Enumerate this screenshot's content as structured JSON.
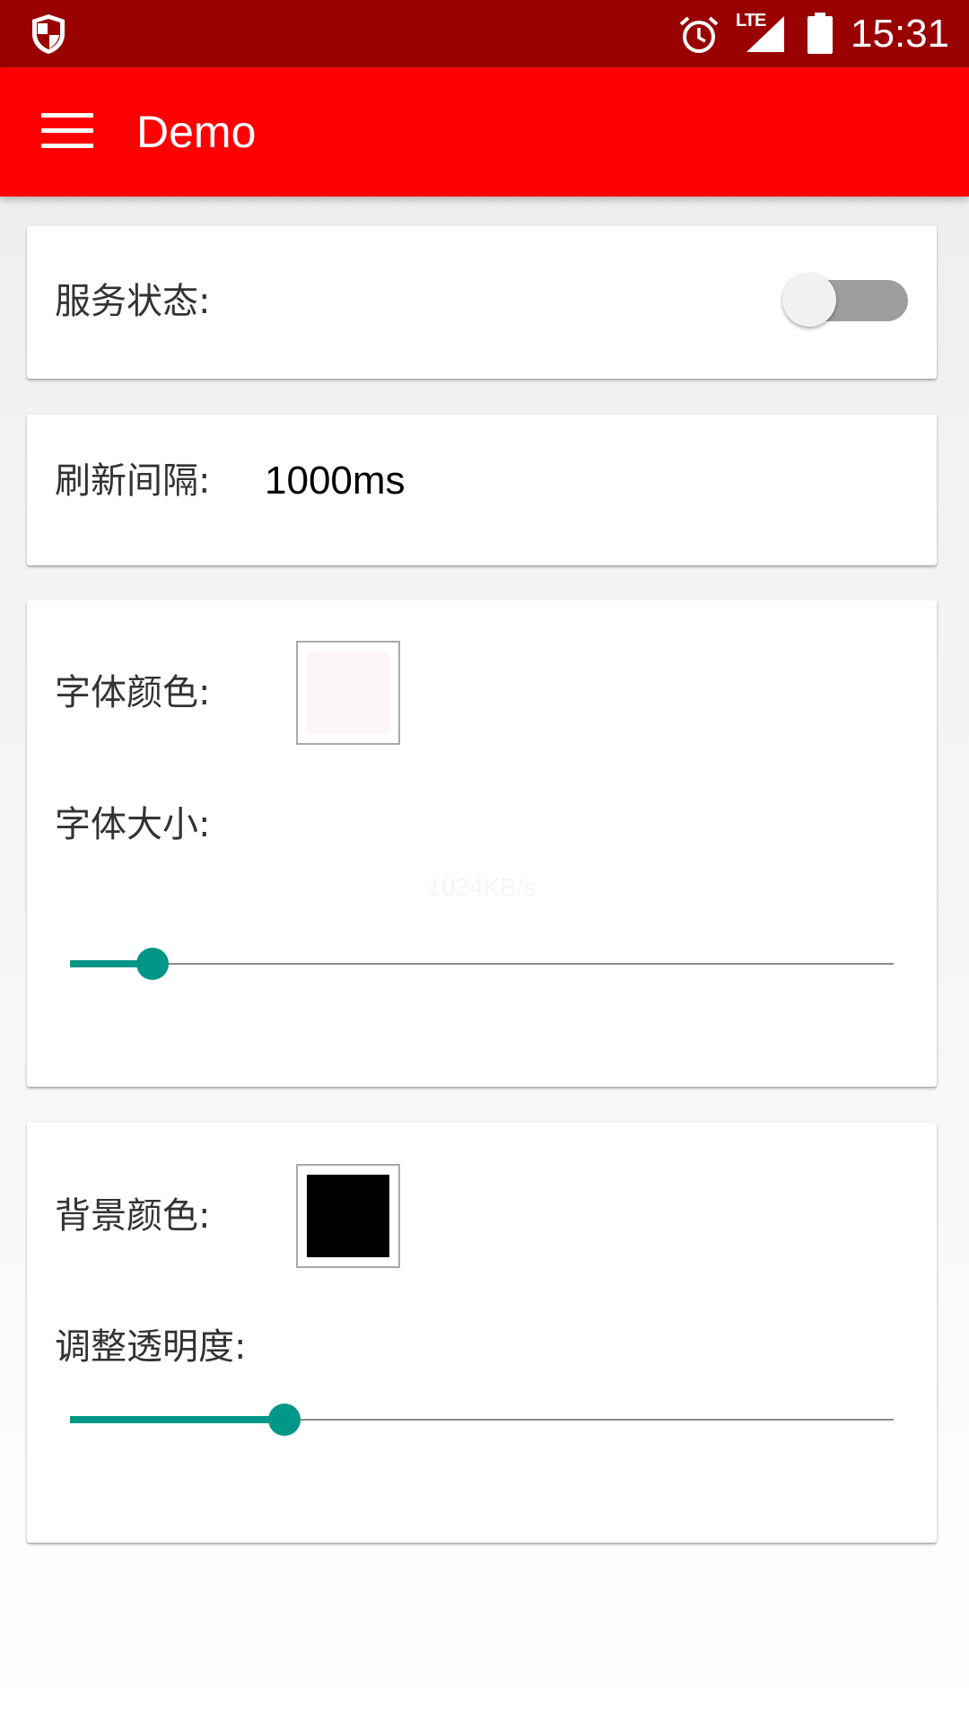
{
  "status_bar": {
    "time": "15:31",
    "network": "LTE",
    "icons": [
      "shield-icon",
      "alarm-icon",
      "signal-icon",
      "battery-icon"
    ]
  },
  "app_bar": {
    "title": "Demo",
    "menu_icon": "hamburger-menu-icon"
  },
  "service": {
    "label": "服务状态:",
    "enabled": false
  },
  "refresh": {
    "label": "刷新间隔:",
    "value": "1000ms"
  },
  "font": {
    "color_label": "字体颜色:",
    "color": "#fdf6f6",
    "size_label": "字体大小:",
    "preview_text": "1024KB/s",
    "size_slider_fraction": 0.1
  },
  "background": {
    "color_label": "背景颜色:",
    "color": "#000000",
    "alpha_label": "调整透明度:",
    "alpha_slider_fraction": 0.26
  },
  "colors": {
    "status_bar": "#990000",
    "app_bar": "#ff0000",
    "accent": "#009688"
  }
}
